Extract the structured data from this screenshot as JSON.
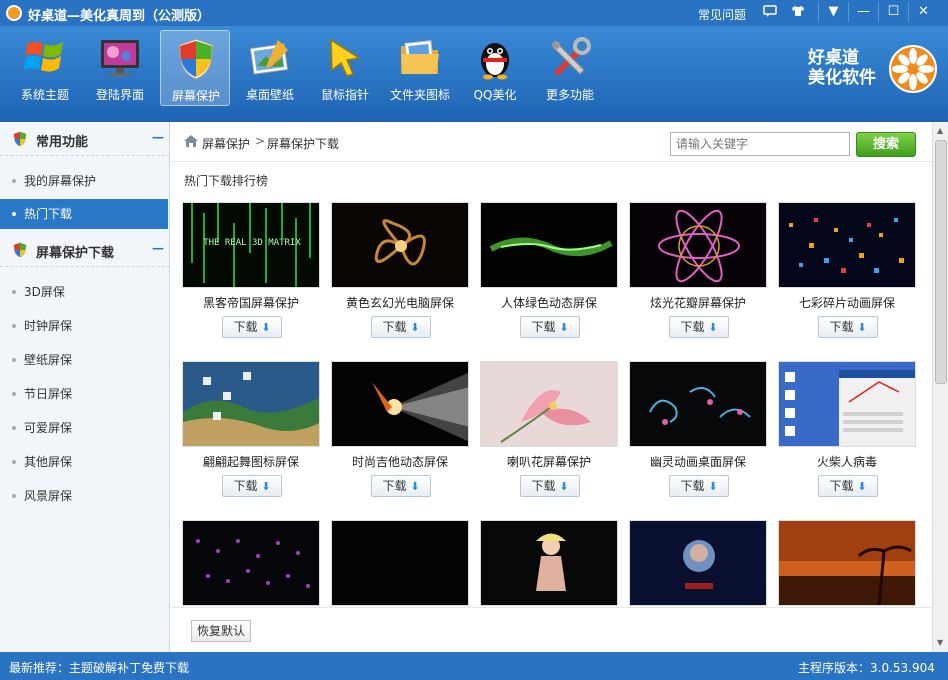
{
  "window": {
    "title": "好桌道—美化真周到（公测版）",
    "faq": "常见问题",
    "controls": {
      "minimize": "—",
      "maximize": "☐",
      "close": "✕"
    }
  },
  "toolbar": {
    "items": [
      {
        "label": "系统主题",
        "icon": "windows-logo-icon"
      },
      {
        "label": "登陆界面",
        "icon": "monitor-icon"
      },
      {
        "label": "屏幕保护",
        "icon": "shield-icon"
      },
      {
        "label": "桌面壁纸",
        "icon": "picture-brush-icon"
      },
      {
        "label": "鼠标指针",
        "icon": "cursor-icon"
      },
      {
        "label": "文件夹图标",
        "icon": "folder-icon"
      },
      {
        "label": "QQ美化",
        "icon": "penguin-icon"
      },
      {
        "label": "更多功能",
        "icon": "tools-icon"
      }
    ],
    "active_index": 2
  },
  "brand": {
    "line1": "好桌道",
    "line2": "美化软件"
  },
  "sidebar": {
    "sections": [
      {
        "title": "常用功能",
        "items": [
          "我的屏幕保护",
          "热门下载"
        ]
      },
      {
        "title": "屏幕保护下载",
        "items": [
          "3D屏保",
          "时钟屏保",
          "壁纸屏保",
          "节日屏保",
          "可爱屏保",
          "其他屏保",
          "风景屏保"
        ]
      }
    ],
    "collapse": "—",
    "active": "热门下载"
  },
  "breadcrumb": {
    "home": "屏幕保护",
    "sep": ">",
    "current": "屏幕保护下载"
  },
  "search": {
    "placeholder": "请输入关键字",
    "button": "搜索"
  },
  "section_title": "热门下载排行榜",
  "download_label": "下载",
  "download_arrow": "⬇",
  "items": [
    {
      "name": "黑客帝国屏幕保护",
      "thumb_text": "THE REAL 3D MATRIX"
    },
    {
      "name": "黄色玄幻光电脑屏保"
    },
    {
      "name": "人体绿色动态屏保"
    },
    {
      "name": "炫光花瓣屏幕保护"
    },
    {
      "name": "七彩碎片动画屏保"
    },
    {
      "name": "翩翩起舞图标屏保"
    },
    {
      "name": "时尚吉他动态屏保"
    },
    {
      "name": "喇叭花屏幕保护"
    },
    {
      "name": "幽灵动画桌面屏保"
    },
    {
      "name": "火柴人病毒"
    }
  ],
  "restore_button": "恢复默认",
  "status": {
    "left": "最新推荐：主题破解补丁免费下载",
    "right": "主程序版本：3.0.53.904"
  }
}
